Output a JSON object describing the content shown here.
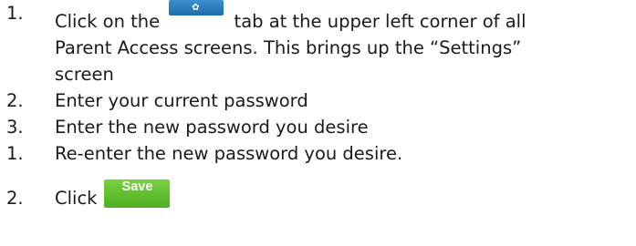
{
  "steps": [
    {
      "number": "1.",
      "text_before": "Click on the",
      "tab_label": "SETTINGS",
      "tab_icon": "gear-icon",
      "text_line1_after": "tab at the upper left corner of all",
      "text_line2": "Parent Access screens.  This brings up the “Settings”",
      "text_line3": "screen"
    },
    {
      "number": "2.",
      "text": "Enter your current password"
    },
    {
      "number": "3.",
      "text": "Enter the new password you desire"
    },
    {
      "number": "1.",
      "text": "Re-enter the new password you desire."
    },
    {
      "number": "2.",
      "text": "Click",
      "button_label": "Save"
    }
  ],
  "colors": {
    "settings_tab": "#2a7cc0",
    "save_button": "#5cbf2a"
  }
}
